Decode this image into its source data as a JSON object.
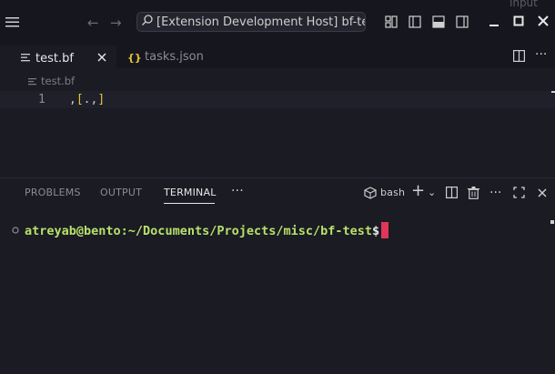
{
  "titlebar": {
    "search_text": "[Extension Development Host] bf-test",
    "overflow_text": "input"
  },
  "tabs": [
    {
      "label": "test.bf",
      "active": true
    },
    {
      "label": "tasks.json",
      "active": false
    }
  ],
  "breadcrumb": "test.bf",
  "editor": {
    "line_number": "1",
    "code_tokens": [
      ",",
      "[",
      ".",
      ",",
      "]"
    ]
  },
  "panel": {
    "tabs": [
      "PROBLEMS",
      "OUTPUT",
      "TERMINAL"
    ],
    "active_tab": "TERMINAL",
    "more": "···",
    "shell_name": "bash",
    "prompt_user": "atreyab@bento",
    "prompt_path": ":~/Documents/Projects/misc/bf-test",
    "prompt_symbol": "$"
  },
  "colors": {
    "accent": "#e8e8e8",
    "prompt_green": "#b8e06a",
    "cursor": "#e0365a",
    "bracket_yellow": "#e8c43a",
    "bracket_purple": "#c878e0"
  }
}
